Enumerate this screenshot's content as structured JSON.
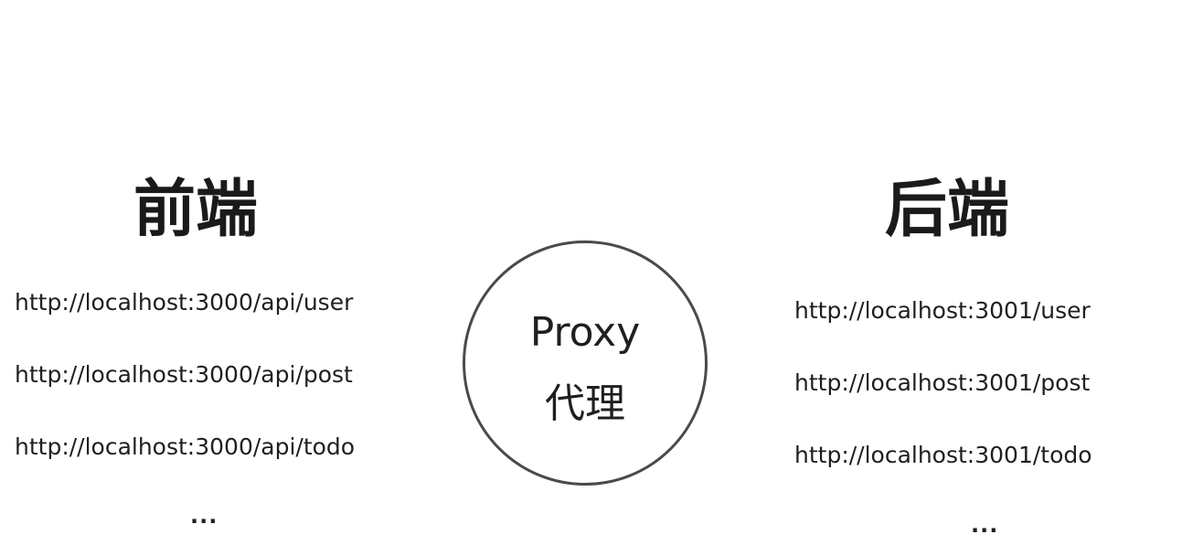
{
  "frontend": {
    "heading": "前端",
    "urls": [
      "http://localhost:3000/api/user",
      "http://localhost:3000/api/post",
      "http://localhost:3000/api/todo"
    ],
    "ellipsis": "..."
  },
  "proxy": {
    "title": "Proxy",
    "subtitle": "代理"
  },
  "backend": {
    "heading": "后端",
    "urls": [
      "http://localhost:3001/user",
      "http://localhost:3001/post",
      "http://localhost:3001/todo"
    ],
    "ellipsis": "..."
  },
  "colors": {
    "text": "#1f1f1f",
    "circle_border": "#4a4a4a",
    "background": "#ffffff"
  }
}
